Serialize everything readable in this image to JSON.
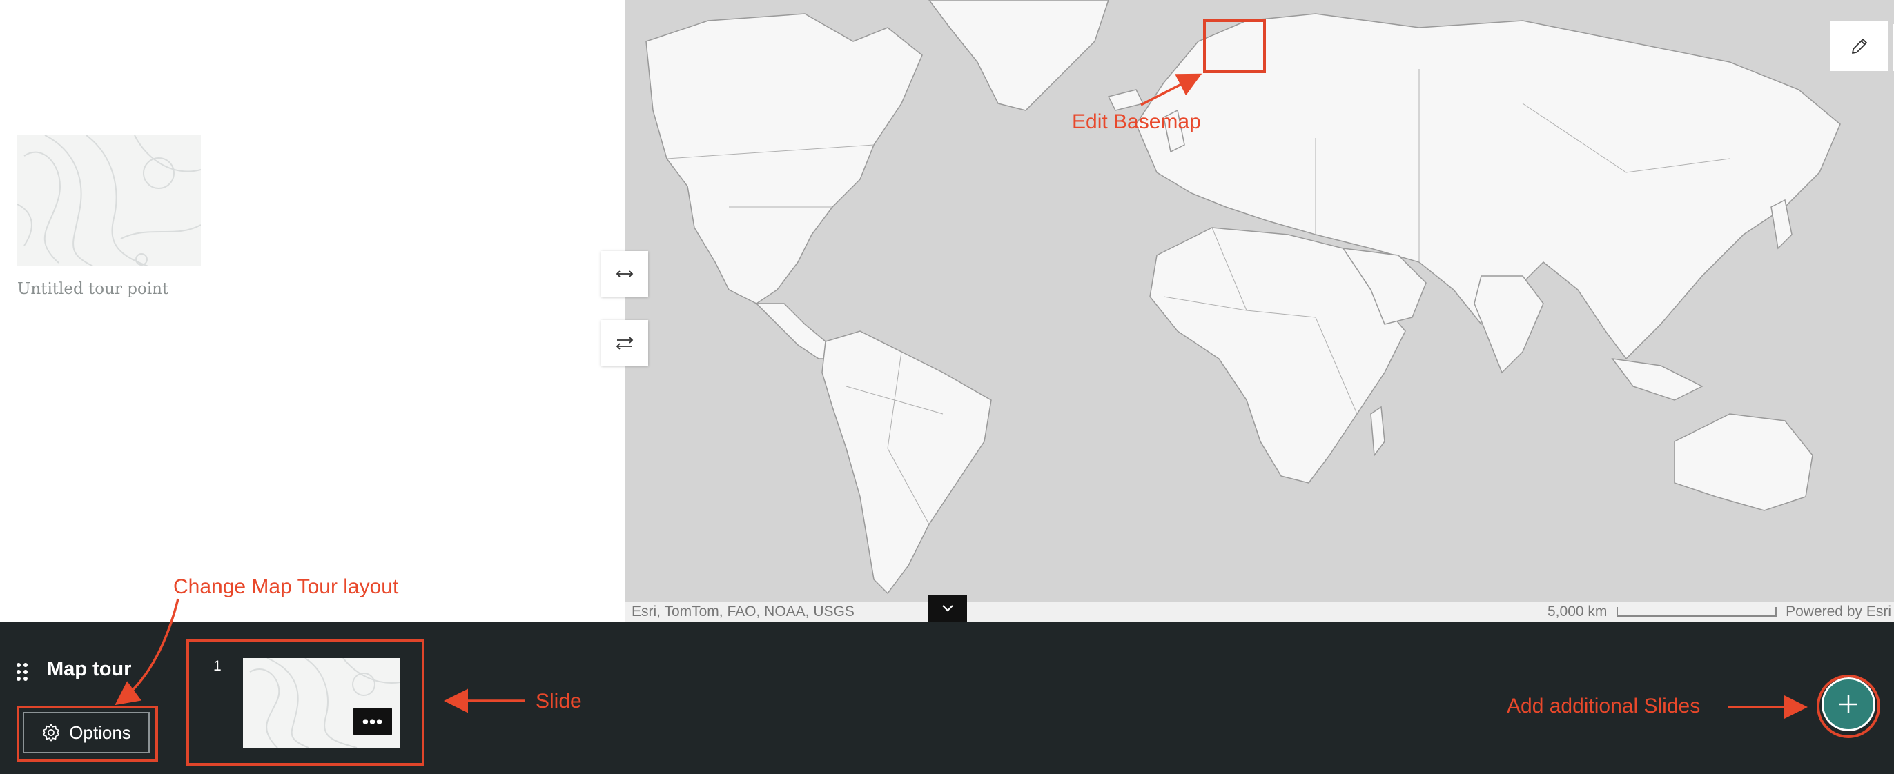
{
  "sidecar": {
    "tour_point_title": "Untitled tour point"
  },
  "map": {
    "attribution": "Esri, TomTom, FAO, NOAA, USGS",
    "scale_label": "5,000 km",
    "powered_by": "Powered by Esri",
    "icons": {
      "swap_width": "swap-width-icon",
      "swap_side": "swap-side-icon",
      "edit_basemap": "pencil-icon",
      "settings": "gear-icon",
      "home": "home-icon",
      "zoom_in": "+",
      "zoom_out": "−",
      "collapse": "chevron-down-icon"
    }
  },
  "carousel": {
    "title": "Map tour",
    "options_label": "Options",
    "slide_number": "1",
    "slide_menu": "•••",
    "add_slide": "plus-icon"
  },
  "annotations": {
    "edit_basemap": "Edit Basemap",
    "change_layout": "Change Map Tour layout",
    "slide": "Slide",
    "add_slides": "Add additional Slides",
    "color": "#e8482b"
  },
  "colors": {
    "carousel_bg": "#202628",
    "map_water": "#d4d4d4",
    "map_land": "#f7f7f7",
    "accent": "#2f8078"
  }
}
